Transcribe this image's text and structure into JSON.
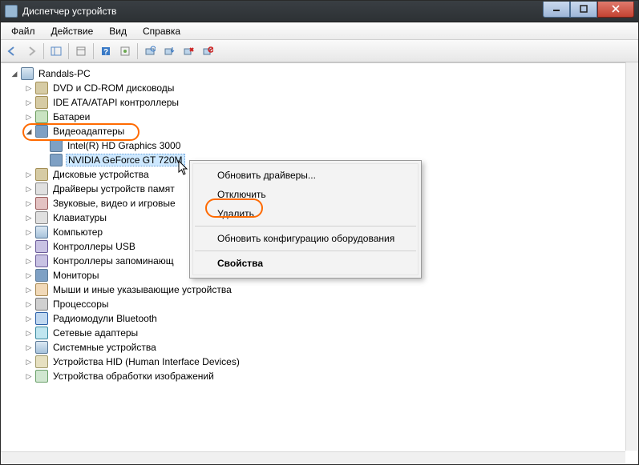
{
  "window": {
    "title": "Диспетчер устройств"
  },
  "menu": {
    "file": "Файл",
    "action": "Действие",
    "view": "Вид",
    "help": "Справка"
  },
  "tree": {
    "root": "Randals-PC",
    "items": [
      {
        "label": "DVD и CD-ROM дисководы"
      },
      {
        "label": "IDE ATA/ATAPI контроллеры"
      },
      {
        "label": "Батареи"
      },
      {
        "label": "Видеоадаптеры",
        "expanded": true,
        "children": [
          {
            "label": "Intel(R) HD Graphics 3000"
          },
          {
            "label": "NVIDIA GeForce GT 720M",
            "selected": true
          }
        ]
      },
      {
        "label": "Дисковые устройства"
      },
      {
        "label": "Драйверы устройств памят"
      },
      {
        "label": "Звуковые, видео и игровые"
      },
      {
        "label": "Клавиатуры"
      },
      {
        "label": "Компьютер"
      },
      {
        "label": "Контроллеры USB"
      },
      {
        "label": "Контроллеры запоминающ"
      },
      {
        "label": "Мониторы"
      },
      {
        "label": "Мыши и иные указывающие устройства"
      },
      {
        "label": "Процессоры"
      },
      {
        "label": "Радиомодули Bluetooth"
      },
      {
        "label": "Сетевые адаптеры"
      },
      {
        "label": "Системные устройства"
      },
      {
        "label": "Устройства HID (Human Interface Devices)"
      },
      {
        "label": "Устройства обработки изображений"
      }
    ]
  },
  "context_menu": {
    "update_drivers": "Обновить драйверы...",
    "disable": "Отключить",
    "delete": "Удалить",
    "refresh_hw": "Обновить конфигурацию оборудования",
    "properties": "Свойства"
  },
  "icons": {
    "classes": [
      "disk",
      "disk",
      "battery",
      "monitor",
      "disk",
      "kb",
      "sound",
      "kb",
      "pc",
      "usb",
      "usb",
      "monitor",
      "mouse",
      "cpu",
      "bt",
      "net",
      "pc",
      "hid",
      "img"
    ]
  }
}
